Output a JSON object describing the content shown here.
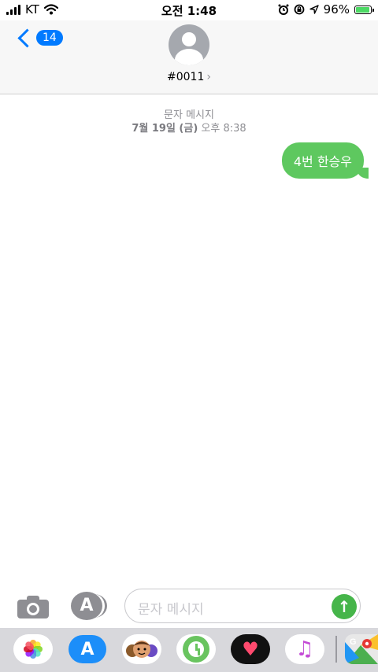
{
  "status_bar": {
    "carrier": "KT",
    "time": "오전 1:48",
    "battery_text": "96%",
    "battery_level": 0.96,
    "icons": [
      "signal-icon",
      "wifi-icon",
      "alarm-icon",
      "rotation-lock-icon",
      "location-icon",
      "battery-icon"
    ]
  },
  "header": {
    "back_badge": "14",
    "contact_name": "#0011",
    "chevron": "›"
  },
  "conversation": {
    "type_label": "문자 메시지",
    "date_bold": "7월 19일 (금)",
    "date_time": "오후 8:38",
    "messages": [
      {
        "text": "4번 한승우",
        "sent": true
      }
    ]
  },
  "compose": {
    "placeholder": "문자 메시지",
    "send_glyph": "↑"
  },
  "app_drawer": {
    "apps": [
      "photos",
      "app-store",
      "memoji",
      "clock",
      "heart",
      "music",
      "maps"
    ]
  },
  "colors": {
    "accent": "#007aff",
    "bubble": "#5ec85f",
    "send": "#46b54a",
    "meta_text": "#8e8e93"
  }
}
